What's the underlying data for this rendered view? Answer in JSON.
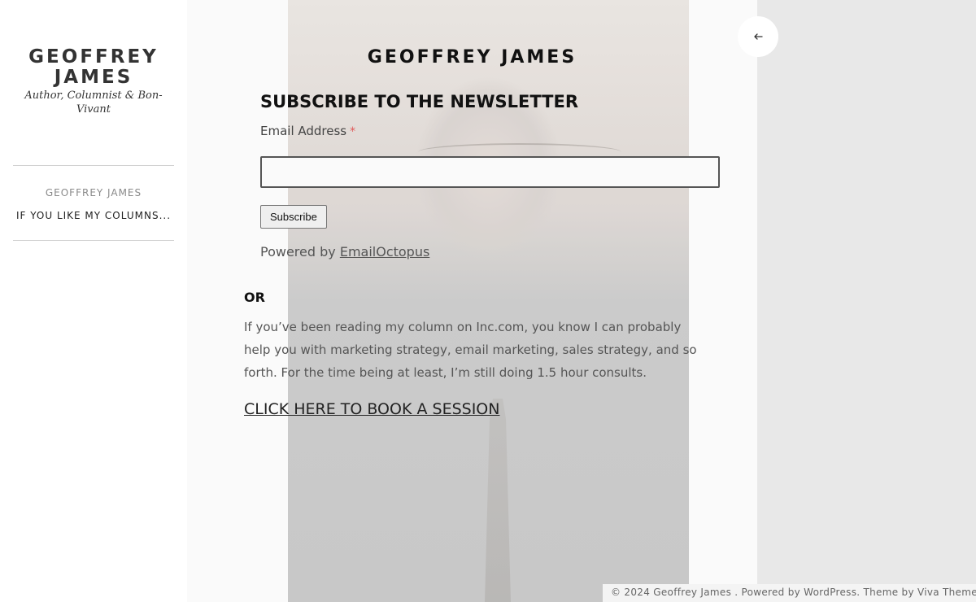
{
  "sidebar": {
    "site_title": "GEOFFREY JAMES",
    "tagline": "Author, Columnist & Bon-Vivant",
    "nav": [
      {
        "label": "GEOFFREY JAMES"
      },
      {
        "label": "IF YOU LIKE MY COLUMNS..."
      }
    ]
  },
  "main": {
    "page_heading": "GEOFFREY JAMES",
    "newsletter": {
      "title": "SUBSCRIBE TO THE NEWSLETTER",
      "email_label": "Email Address",
      "required_mark": "*",
      "email_value": "",
      "subscribe_label": "Subscribe",
      "powered_by_prefix": "Powered by",
      "powered_by_link": "EmailOctopus"
    },
    "or_heading": "OR",
    "paragraph": "If you’ve been reading my column on Inc.com, you know I can probably help you with marketing strategy, email marketing, sales strategy, and so forth. For the time being at least, I’m still doing 1.5 hour consults.",
    "book_link": "CLICK HERE TO BOOK A SESSION"
  },
  "back_button": {
    "icon": "arrow-left-icon"
  },
  "footer": {
    "copyright": "© 2024 Geoffrey James",
    "sep": " . ",
    "powered": "Powered by WordPress.",
    "theme": "Theme by Viva Themes."
  },
  "colors": {
    "sidebar_bg": "#ffffff",
    "main_bg": "#fafafa",
    "page_bg": "#e8e8e8",
    "required": "#e05a5a"
  }
}
